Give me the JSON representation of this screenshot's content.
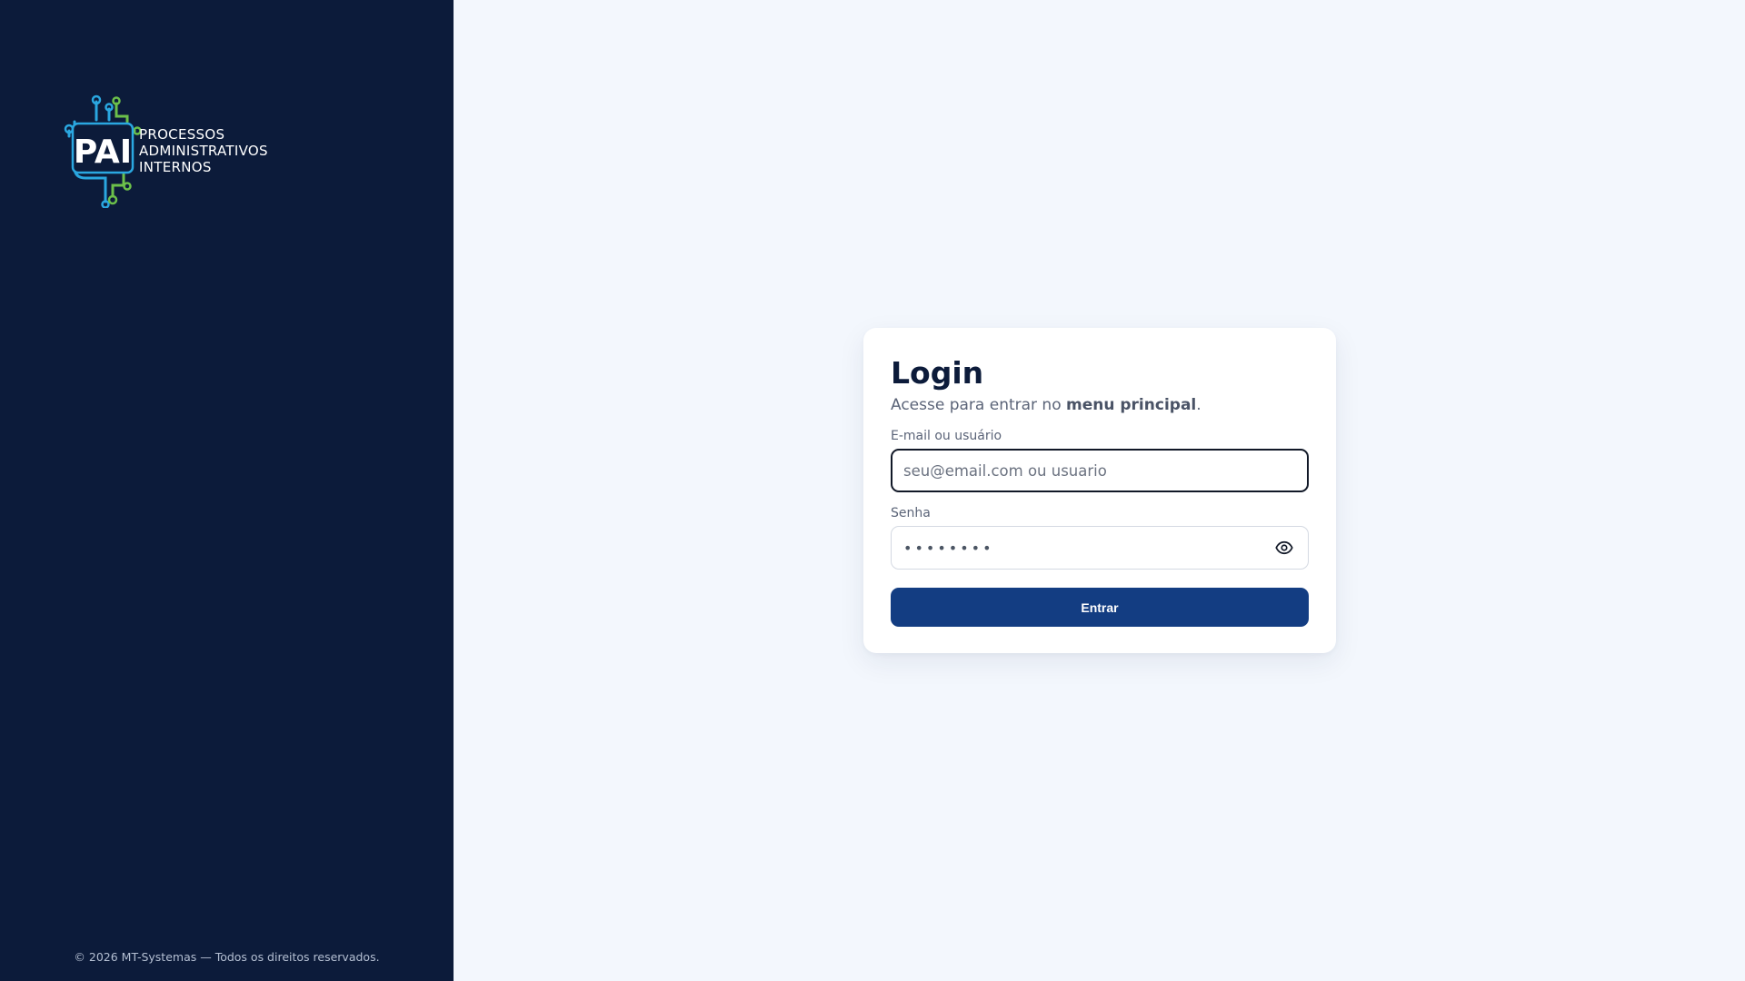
{
  "brand": {
    "logo_text": "PAI",
    "name_lines": [
      "PROCESSOS",
      "ADMINISTRATIVOS",
      "INTERNOS"
    ],
    "colors": {
      "blue": "#2aa7e0",
      "green": "#6cc04a",
      "sidebar": "#0c1b3a"
    }
  },
  "footer": {
    "copyright": "© 2026 MT-Systemas — Todos os direitos reservados."
  },
  "login": {
    "title": "Login",
    "subtitle_prefix": "Acesse para entrar no ",
    "subtitle_bold": "menu principal",
    "subtitle_suffix": ".",
    "email_label": "E-mail ou usuário",
    "email_placeholder": "seu@email.com ou usuario",
    "email_value": "",
    "password_label": "Senha",
    "password_masked": "••••••••",
    "submit_label": "Entrar",
    "accent_color": "#133d82"
  },
  "icons": {
    "password_toggle": "eye-icon"
  }
}
